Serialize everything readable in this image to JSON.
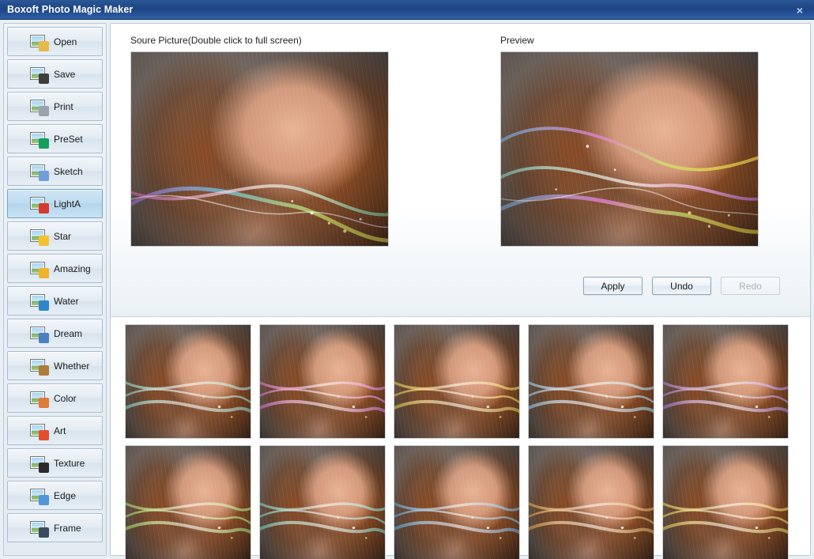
{
  "window": {
    "title": "Boxoft Photo Magic Maker",
    "close_label": "×",
    "close_icon": "close-icon"
  },
  "sidebar": {
    "items": [
      {
        "label": "Open",
        "icon": "open-folder-icon",
        "selected": false,
        "badge": "#e8b94a"
      },
      {
        "label": "Save",
        "icon": "floppy-save-icon",
        "selected": false,
        "badge": "#3c3c3c"
      },
      {
        "label": "Print",
        "icon": "printer-icon",
        "selected": false,
        "badge": "#9aa3ad"
      },
      {
        "label": "PreSet",
        "icon": "preset-gear-icon",
        "selected": false,
        "badge": "#13a05a"
      },
      {
        "label": "Sketch",
        "icon": "pencil-sketch-icon",
        "selected": false,
        "badge": "#6f9ed8"
      },
      {
        "label": "LightA",
        "icon": "light-effect-icon",
        "selected": true,
        "badge": "#d7382f"
      },
      {
        "label": "Star",
        "icon": "star-icon",
        "selected": false,
        "badge": "#f2c230"
      },
      {
        "label": "Amazing",
        "icon": "smiley-icon",
        "selected": false,
        "badge": "#f0b429"
      },
      {
        "label": "Water",
        "icon": "water-drop-icon",
        "selected": false,
        "badge": "#2e86c8"
      },
      {
        "label": "Dream",
        "icon": "dream-swirl-icon",
        "selected": false,
        "badge": "#4a7fc1"
      },
      {
        "label": "Whether",
        "icon": "weather-icon",
        "selected": false,
        "badge": "#b07a3c"
      },
      {
        "label": "Color",
        "icon": "palette-icon",
        "selected": false,
        "badge": "#e07b39"
      },
      {
        "label": "Art",
        "icon": "art-brush-icon",
        "selected": false,
        "badge": "#e34f2d"
      },
      {
        "label": "Texture",
        "icon": "texture-a-icon",
        "selected": false,
        "badge": "#2b2b2b"
      },
      {
        "label": "Edge",
        "icon": "edge-diamond-icon",
        "selected": false,
        "badge": "#4f97d8"
      },
      {
        "label": "Frame",
        "icon": "frame-icon",
        "selected": false,
        "badge": "#3a4b5c"
      }
    ]
  },
  "main": {
    "source_label": "Soure Picture(Double click to full screen)",
    "preview_label": "Preview",
    "buttons": {
      "apply": "Apply",
      "undo": "Undo",
      "redo": "Redo",
      "redo_disabled": true
    },
    "source_image": {
      "alt": "Portrait of woman with auburn hair and colorful light streaks",
      "effect": "light-streaks-rainbow"
    },
    "preview_image": {
      "alt": "Preview of portrait with enhanced multicolor light swirl effect",
      "effect": "light-streaks-rainbow-enhanced"
    }
  },
  "thumbnails": {
    "rows": [
      [
        {
          "effect": "cool-rainbow-wave",
          "accent": "#8fd8c8"
        },
        {
          "effect": "magenta-crossweave",
          "accent": "#e46fd0"
        },
        {
          "effect": "gold-loop-swirl",
          "accent": "#f2c93a"
        },
        {
          "effect": "soft-pastel-streak",
          "accent": "#9fd3f0"
        },
        {
          "effect": "violet-glow-band",
          "accent": "#b07ae0"
        }
      ],
      [
        {
          "effect": "lime-spiral-light",
          "accent": "#a8e05a"
        },
        {
          "effect": "music-note-overlay",
          "accent": "#7fd4c2"
        },
        {
          "effect": "blue-ribbon-flow",
          "accent": "#5fa8e0"
        },
        {
          "effect": "warm-amber-curve",
          "accent": "#e8a33a"
        },
        {
          "effect": "yellow-arc-sparkle",
          "accent": "#f0d040"
        }
      ]
    ]
  }
}
